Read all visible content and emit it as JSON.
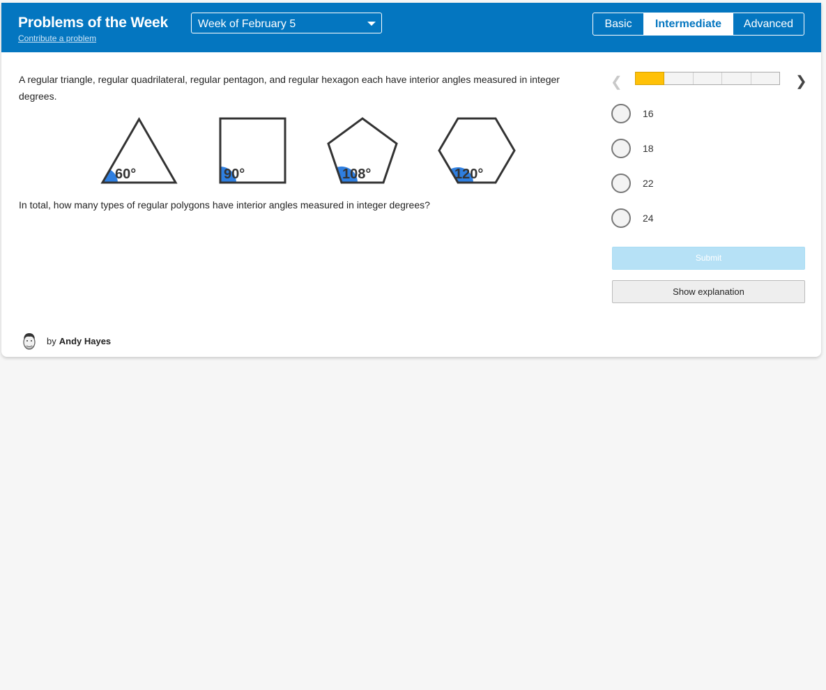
{
  "header": {
    "title": "Problems of the Week",
    "contribute_link": "Contribute a problem",
    "week_selector": {
      "selected": "Week of February 5"
    },
    "levels": [
      {
        "label": "Basic",
        "active": false
      },
      {
        "label": "Intermediate",
        "active": true
      },
      {
        "label": "Advanced",
        "active": false
      }
    ]
  },
  "problem": {
    "intro": "A regular triangle, regular quadrilateral, regular pentagon, and regular hexagon each have interior angles measured in integer degrees.",
    "question": "In total, how many types of regular polygons have interior angles measured in integer degrees?",
    "figure": {
      "shapes": [
        {
          "name": "triangle",
          "angle_label": "60°"
        },
        {
          "name": "square",
          "angle_label": "90°"
        },
        {
          "name": "pentagon",
          "angle_label": "108°"
        },
        {
          "name": "hexagon",
          "angle_label": "120°"
        }
      ],
      "angle_color": "#2f7fe0"
    }
  },
  "navigator": {
    "segments": 5,
    "active_segment": 1,
    "active_color": "#ffc107"
  },
  "choices": [
    {
      "label": "16"
    },
    {
      "label": "18"
    },
    {
      "label": "22"
    },
    {
      "label": "24"
    }
  ],
  "buttons": {
    "submit": "Submit",
    "show_explanation": "Show explanation"
  },
  "author": {
    "by": "by",
    "name": "Andy Hayes"
  },
  "colors": {
    "header_bg": "#0476c0",
    "submit_disabled": "#b6e1f6"
  }
}
